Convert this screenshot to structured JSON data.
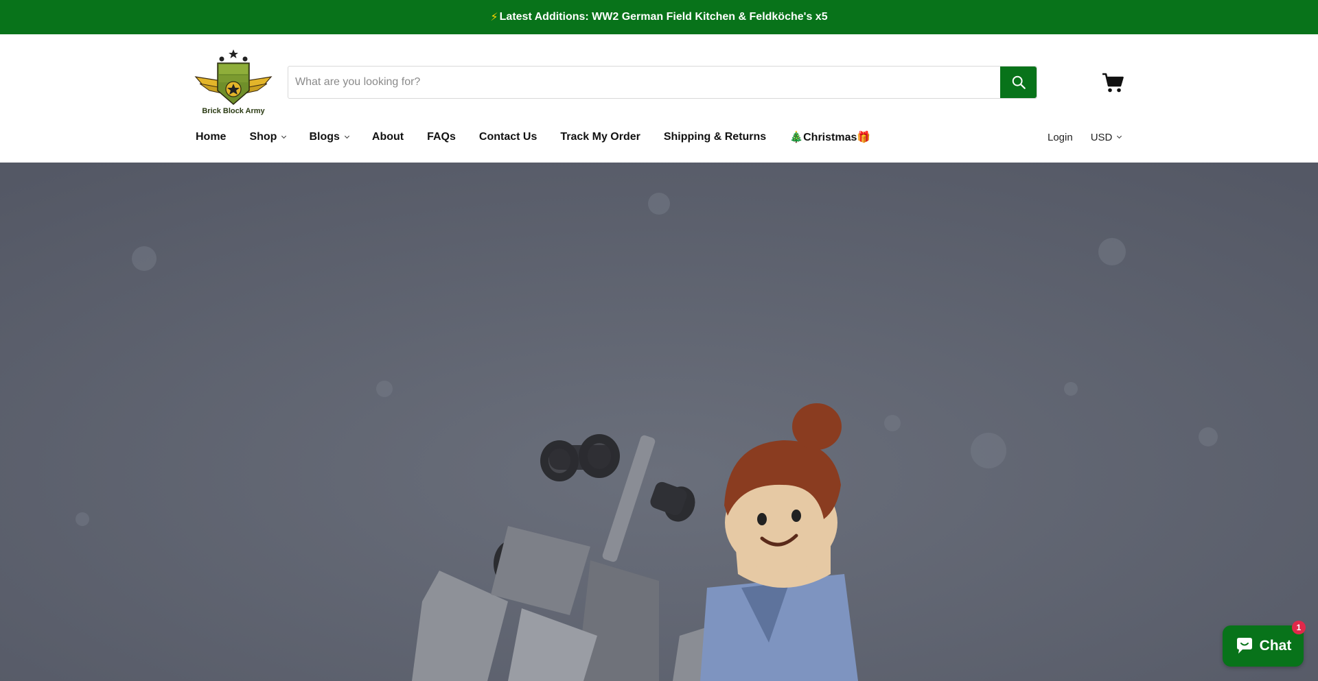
{
  "announcement": {
    "icon": "lightning-bolt-icon",
    "icon_glyph": "⚡",
    "text": "Latest Additions: WW2 German Field Kitchen & Feldköche's x5"
  },
  "brand": {
    "logo_text": "Brick Block Army",
    "accent_color": "#08731a"
  },
  "search": {
    "placeholder": "What are you looking for?",
    "value": "",
    "button_icon": "search-icon"
  },
  "cart": {
    "icon": "cart-icon"
  },
  "nav": {
    "items": [
      {
        "label": "Home"
      },
      {
        "label": "Shop"
      },
      {
        "label": "Blogs"
      },
      {
        "label": "About"
      },
      {
        "label": "FAQs"
      },
      {
        "label": "Contact Us"
      },
      {
        "label": "Track My Order"
      },
      {
        "label": "Shipping & Returns"
      },
      {
        "label": "🎄Christmas🎁"
      }
    ],
    "login": "Login",
    "currency": "USD"
  },
  "chat": {
    "label": "Chat",
    "badge": "1"
  }
}
